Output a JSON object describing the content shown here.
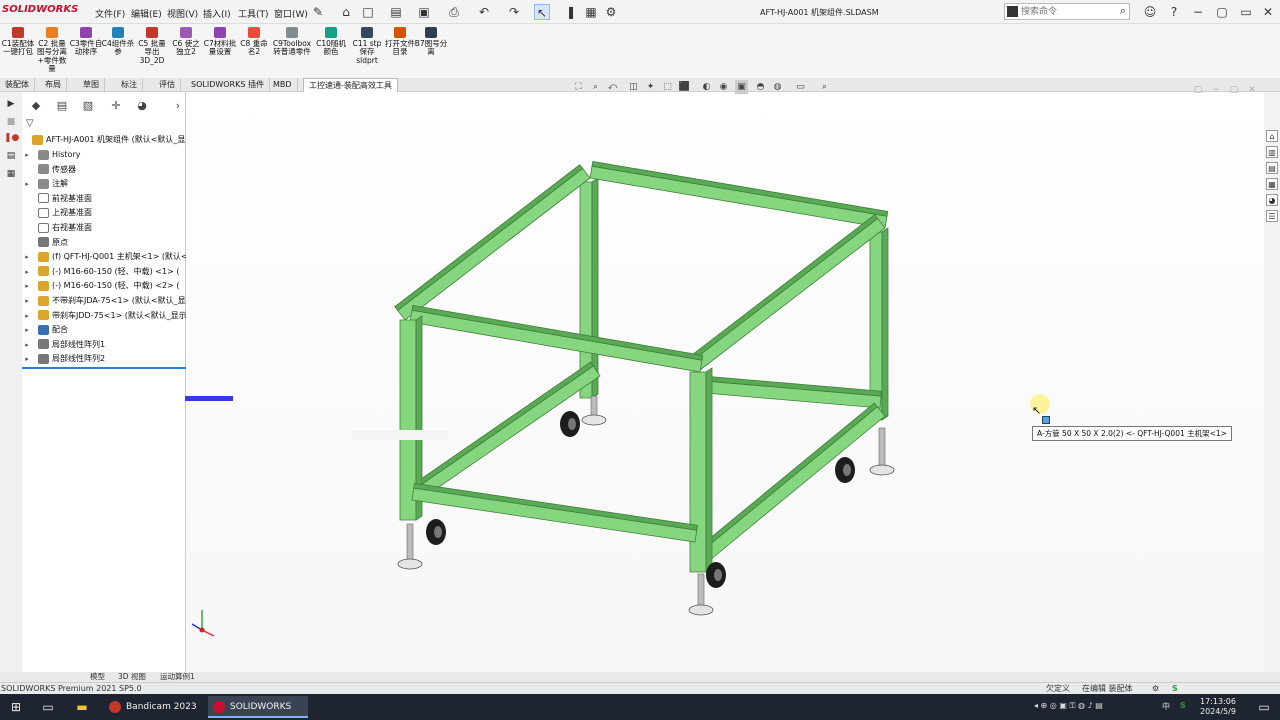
{
  "app": {
    "logo_text": "SOLIDWORKS",
    "document_title": "AFT-HJ-A001 机架组件.SLDASM"
  },
  "menu": [
    "文件(F)",
    "编辑(E)",
    "视图(V)",
    "插入(I)",
    "工具(T)",
    "窗口(W)"
  ],
  "search": {
    "placeholder": "搜索命令"
  },
  "commands": [
    {
      "label": "C1装配体一键打包",
      "color": "#c0392b"
    },
    {
      "label": "C2 批量图号分离+零件数量",
      "color": "#e67e22"
    },
    {
      "label": "C3零件自动排序",
      "color": "#8e44ad"
    },
    {
      "label": "C4组件杀参",
      "color": "#2980b9"
    },
    {
      "label": "C5 批量导出3D_2D",
      "color": "#c0392b"
    },
    {
      "label": "C6 使之独立2",
      "color": "#9b59b6"
    },
    {
      "label": "C7材料批量设置",
      "color": "#8e44ad"
    },
    {
      "label": "C8 重命名2",
      "color": "#e74c3c"
    },
    {
      "label": "C9Toolbox转普通零件",
      "color": "#7f8c8d"
    },
    {
      "label": "C10随机颜色",
      "color": "#16a085"
    },
    {
      "label": "C11 stp保存sldprt",
      "color": "#34495e"
    },
    {
      "label": "打开文件目录",
      "color": "#d35400"
    },
    {
      "label": "B7图号分离",
      "color": "#2c3e50"
    }
  ],
  "tabs": [
    "装配体",
    "布局",
    "草图",
    "标注",
    "评估",
    "SOLIDWORKS 插件",
    "MBD",
    "工控速通-装配高效工具"
  ],
  "active_tab_index": 7,
  "tree": {
    "root": "AFT-HJ-A001 机架组件 (默认<默认_显示",
    "items": [
      {
        "label": "History",
        "icon": "fold",
        "expander": true
      },
      {
        "label": "传感器",
        "icon": "fold",
        "expander": false
      },
      {
        "label": "注解",
        "icon": "fold",
        "expander": true
      },
      {
        "label": "前视基准面",
        "icon": "plane",
        "expander": false
      },
      {
        "label": "上视基准面",
        "icon": "plane",
        "expander": false
      },
      {
        "label": "右视基准面",
        "icon": "plane",
        "expander": false
      },
      {
        "label": "原点",
        "icon": "gray",
        "expander": false
      },
      {
        "label": "(f) QFT-HJ-Q001 主机架<1> (默认<",
        "icon": "gold",
        "expander": true
      },
      {
        "label": "(-) M16-60-150 (轻、中载) <1> (",
        "icon": "gold",
        "expander": true
      },
      {
        "label": "(-) M16-60-150 (轻、中载) <2> (",
        "icon": "gold",
        "expander": true
      },
      {
        "label": "不带刹车JDA-75<1> (默认<默认_显",
        "icon": "gold",
        "expander": true
      },
      {
        "label": "带刹车JDD-75<1> (默认<默认_显示",
        "icon": "gold",
        "expander": true
      },
      {
        "label": "配合",
        "icon": "blue",
        "expander": true
      },
      {
        "label": "局部线性阵列1",
        "icon": "gray",
        "expander": true
      },
      {
        "label": "局部线性阵列2",
        "icon": "gray",
        "expander": true
      }
    ]
  },
  "tooltip": "A-方管 50 X 50 X 2.0(2) <- QFT-HJ-Q001 主机架<1>",
  "bottom_tabs": [
    "模型",
    "3D 视图",
    "运动算例1"
  ],
  "status": {
    "left": "SOLIDWORKS Premium 2021 SP5.0",
    "undefined": "欠定义",
    "editing": "在编辑 装配体"
  },
  "taskbar": {
    "apps": [
      {
        "label": "Bandicam 2023",
        "color": "#c0392b"
      },
      {
        "label": "SOLIDWORKS Pr...",
        "color": "#c8102e"
      }
    ],
    "tray_text": "中",
    "time": "17:13:06",
    "date": "2024/5/9"
  },
  "colors": {
    "frame": "#86d67f",
    "frame_dark": "#5aa954",
    "accent": "#c8102e"
  }
}
